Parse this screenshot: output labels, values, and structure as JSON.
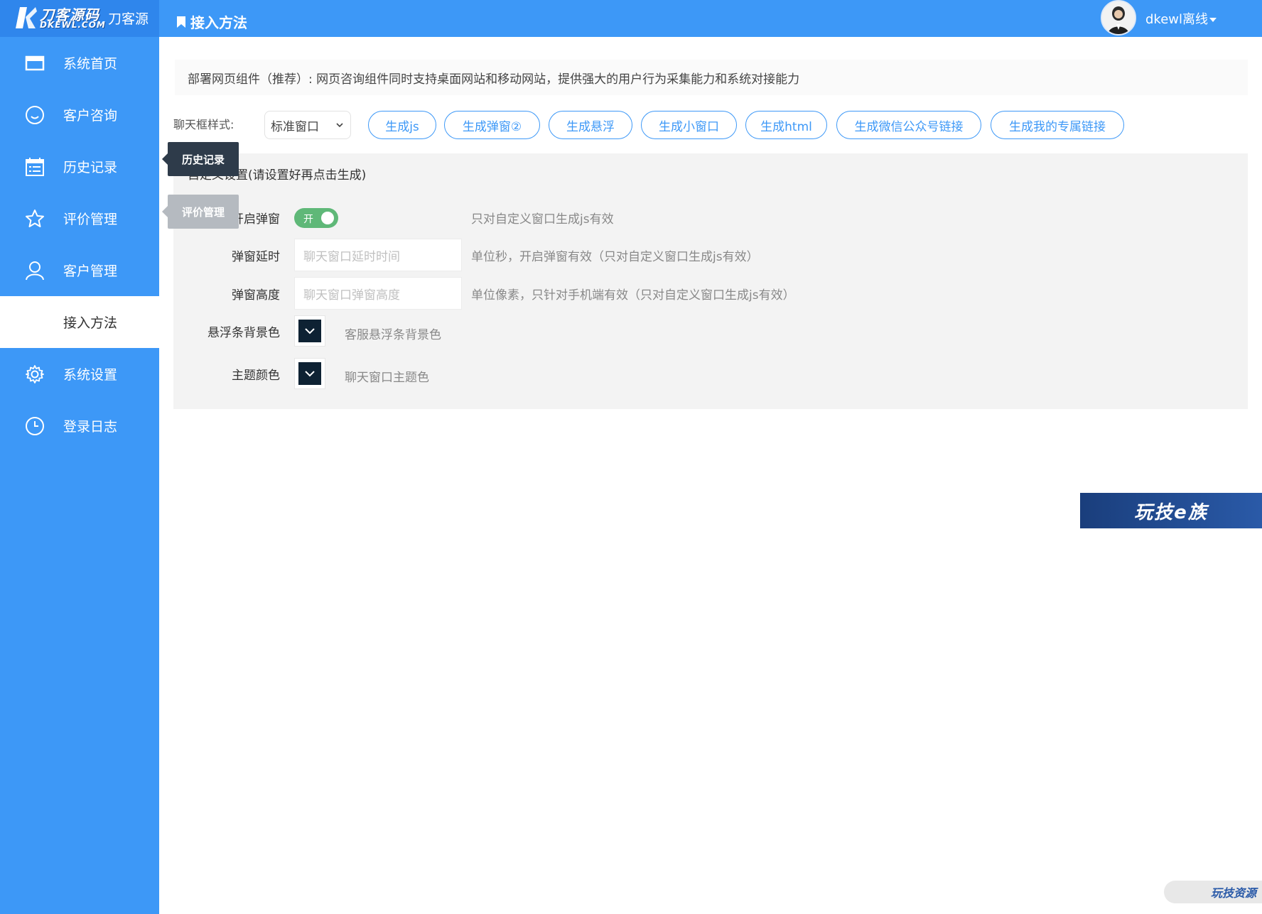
{
  "header": {
    "logo_text": "刀客源码",
    "logo_sub": "DKEWL.COM",
    "site_name": "刀客源",
    "page_title": "接入方法",
    "user_label": "dkewl离线"
  },
  "sidebar": {
    "items": [
      {
        "label": "系统首页",
        "icon": "window-icon"
      },
      {
        "label": "客户咨询",
        "icon": "smile-icon"
      },
      {
        "label": "历史记录",
        "icon": "calendar-list-icon"
      },
      {
        "label": "评价管理",
        "icon": "star-icon"
      },
      {
        "label": "客户管理",
        "icon": "user-icon"
      },
      {
        "label": "接入方法",
        "icon": "",
        "active": true
      },
      {
        "label": "系统设置",
        "icon": "gear-icon"
      },
      {
        "label": "登录日志",
        "icon": "clock-icon"
      }
    ]
  },
  "tooltips": {
    "history": "历史记录",
    "rating": "评价管理"
  },
  "main": {
    "notice": "部署网页组件（推荐）: 网页咨询组件同时支持桌面网站和移动网站，提供强大的用户行为采集能力和系统对接能力",
    "style_label": "聊天框样式:",
    "style_select_value": "标准窗口",
    "buttons": [
      "生成js",
      "生成弹窗②",
      "生成悬浮",
      "生成小窗口",
      "生成html",
      "生成微信公众号链接",
      "生成我的专属链接"
    ],
    "panel_title": "自定义设置(请设置好再点击生成)",
    "rows": {
      "popup_label": "开启弹窗",
      "popup_toggle": "开",
      "popup_hint": "只对自定义窗口生成js有效",
      "delay_label": "弹窗延时",
      "delay_placeholder": "聊天窗口延时时间",
      "delay_hint": "单位秒，开启弹窗有效（只对自定义窗口生成js有效）",
      "height_label": "弹窗高度",
      "height_placeholder": "聊天窗口弹窗高度",
      "height_hint": "单位像素，只针对手机端有效（只对自定义窗口生成js有效）",
      "float_bg_label": "悬浮条背景色",
      "float_bg_hint": "客服悬浮条背景色",
      "theme_label": "主题颜色",
      "theme_hint": "聊天窗口主题色"
    },
    "picker_color": "#0e2233"
  },
  "watermarks": {
    "banner": "玩技e族",
    "corner": "玩技资源"
  },
  "colors": {
    "brand": "#3d98f7",
    "toggle_on": "#5fb878"
  }
}
